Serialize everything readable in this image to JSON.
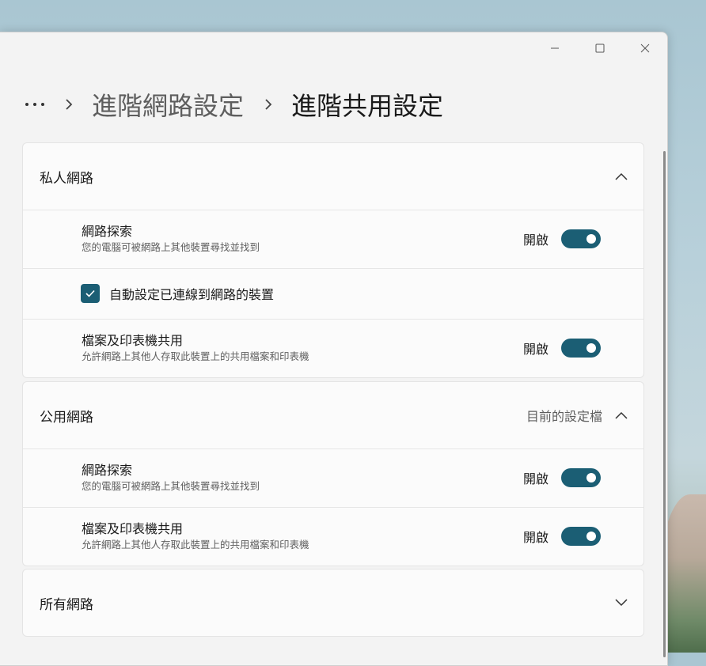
{
  "window": {
    "caption_buttons": [
      "minimize",
      "maximize",
      "close"
    ]
  },
  "breadcrumb": {
    "parent": "進階網路設定",
    "current": "進階共用設定"
  },
  "private_network": {
    "title": "私人網路",
    "expanded": true,
    "network_discovery": {
      "title": "網路探索",
      "description": "您的電腦可被網路上其他裝置尋找並找到",
      "state": "開啟",
      "on": true
    },
    "auto_setup": {
      "label": "自動設定已連線到網路的裝置",
      "checked": true
    },
    "file_printer_sharing": {
      "title": "檔案及印表機共用",
      "description": "允許網路上其他人存取此裝置上的共用檔案和印表機",
      "state": "開啟",
      "on": true
    }
  },
  "public_network": {
    "title": "公用網路",
    "profile_label": "目前的設定檔",
    "expanded": true,
    "network_discovery": {
      "title": "網路探索",
      "description": "您的電腦可被網路上其他裝置尋找並找到",
      "state": "開啟",
      "on": true
    },
    "file_printer_sharing": {
      "title": "檔案及印表機共用",
      "description": "允許網路上其他人存取此裝置上的共用檔案和印表機",
      "state": "開啟",
      "on": true
    }
  },
  "all_networks": {
    "title": "所有網路",
    "expanded": false
  },
  "colors": {
    "accent": "#1b5e74",
    "window_bg": "#f3f3f3",
    "card_bg": "#fbfbfb"
  }
}
